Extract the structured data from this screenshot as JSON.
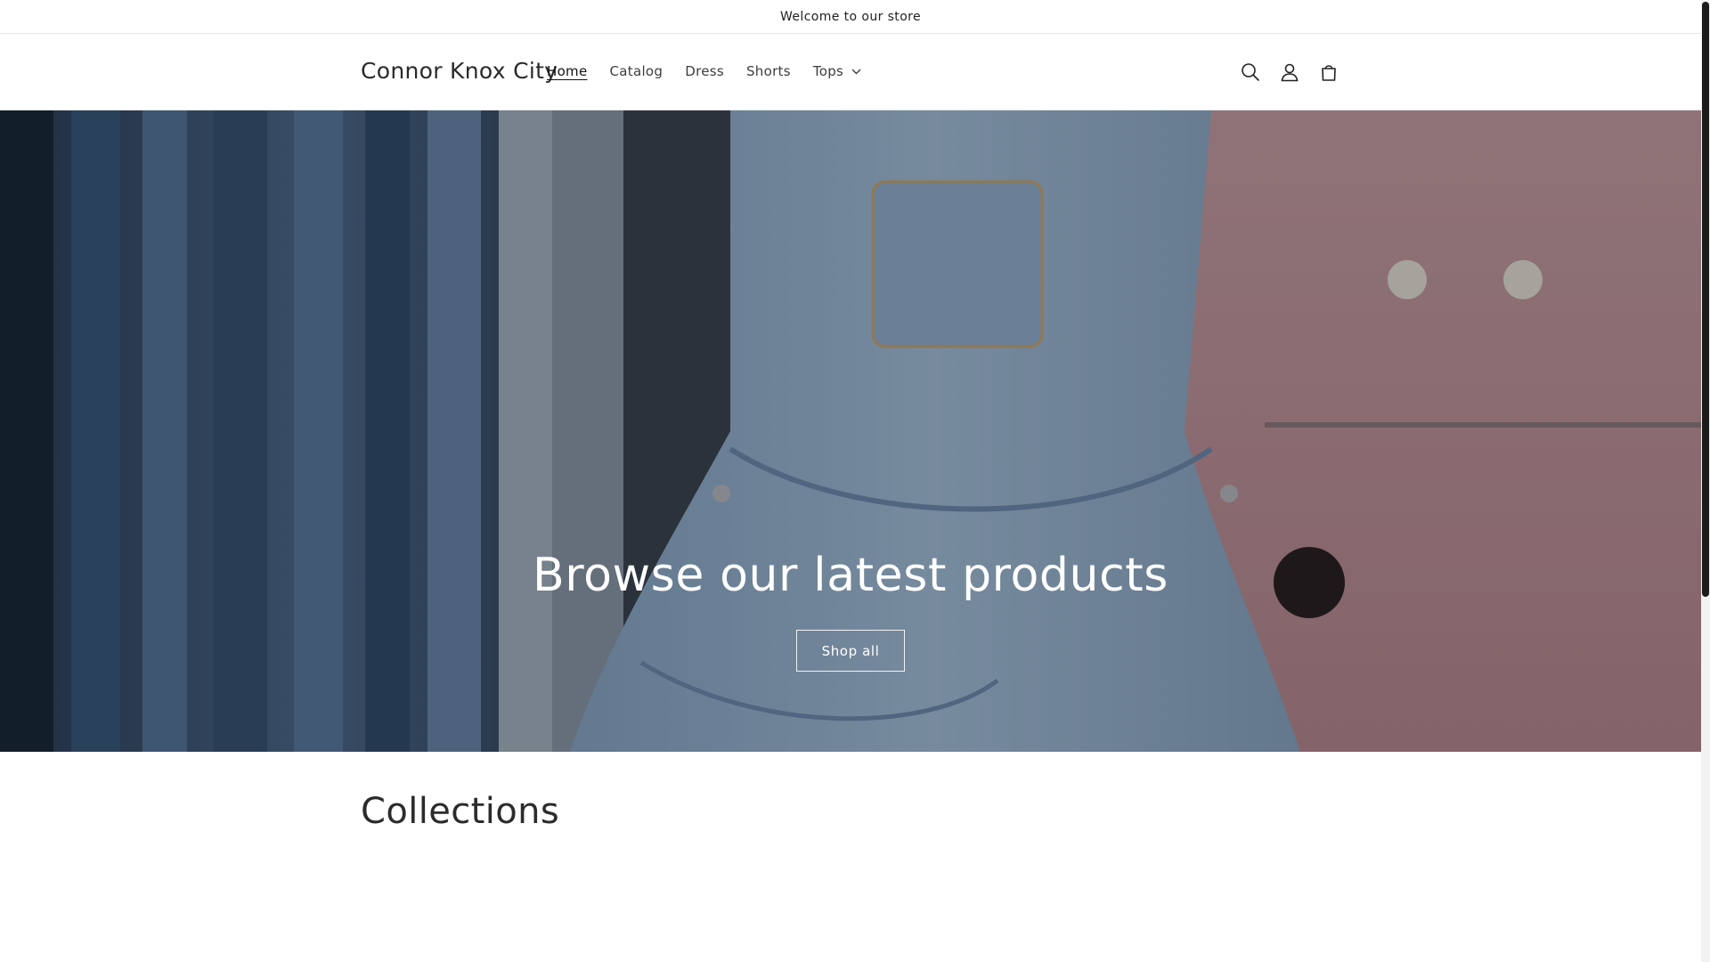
{
  "announcement": {
    "text": "Welcome to our store"
  },
  "header": {
    "logo": "Connor Knox City",
    "nav": [
      {
        "label": "Home",
        "active": true
      },
      {
        "label": "Catalog"
      },
      {
        "label": "Dress"
      },
      {
        "label": "Shorts"
      },
      {
        "label": "Tops",
        "has_dropdown": true
      }
    ],
    "icons": [
      "search-icon",
      "account-icon",
      "cart-icon"
    ]
  },
  "hero": {
    "heading": "Browse our latest products",
    "button_label": "Shop all"
  },
  "collections": {
    "title": "Collections"
  },
  "colors": {
    "text": "#121212",
    "hero_text": "#ffffff",
    "border": "#e6e6e6"
  }
}
